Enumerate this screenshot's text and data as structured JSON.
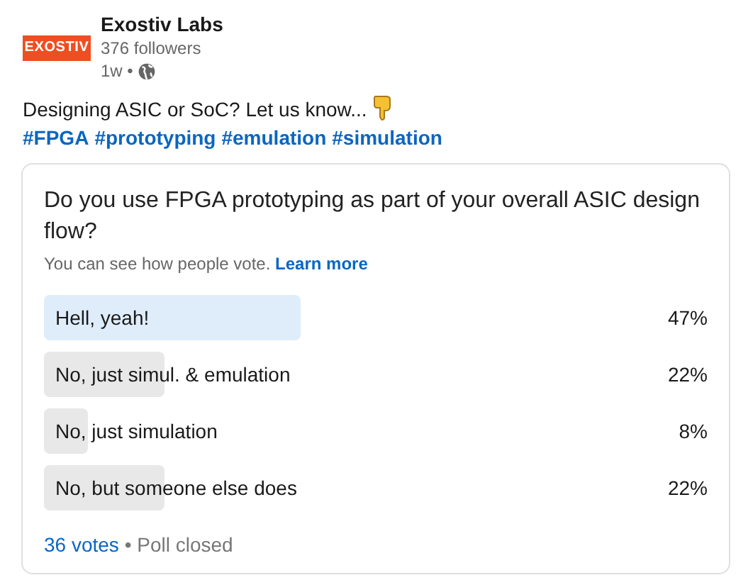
{
  "author": {
    "logo_text": "EXOSTIV",
    "name": "Exostiv Labs",
    "followers": "376 followers",
    "time": "1w •"
  },
  "post": {
    "text": "Designing ASIC or SoC? Let us know...",
    "hashtags": [
      "#FPGA",
      "#prototyping",
      "#emulation",
      "#simulation"
    ]
  },
  "poll": {
    "question": "Do you use FPGA prototyping as part of your overall ASIC design flow?",
    "note": "You can see how people vote.",
    "note_link": "Learn more",
    "options": [
      {
        "label": "Hell, yeah!",
        "percent": "47%",
        "selected": true
      },
      {
        "label": "No, just simul. & emulation",
        "percent": "22%",
        "selected": false
      },
      {
        "label": "No, just simulation",
        "percent": "8%",
        "selected": false
      },
      {
        "label": "No, but someone else does",
        "percent": "22%",
        "selected": false
      }
    ],
    "votes": "36 votes",
    "status": "• Poll closed"
  }
}
